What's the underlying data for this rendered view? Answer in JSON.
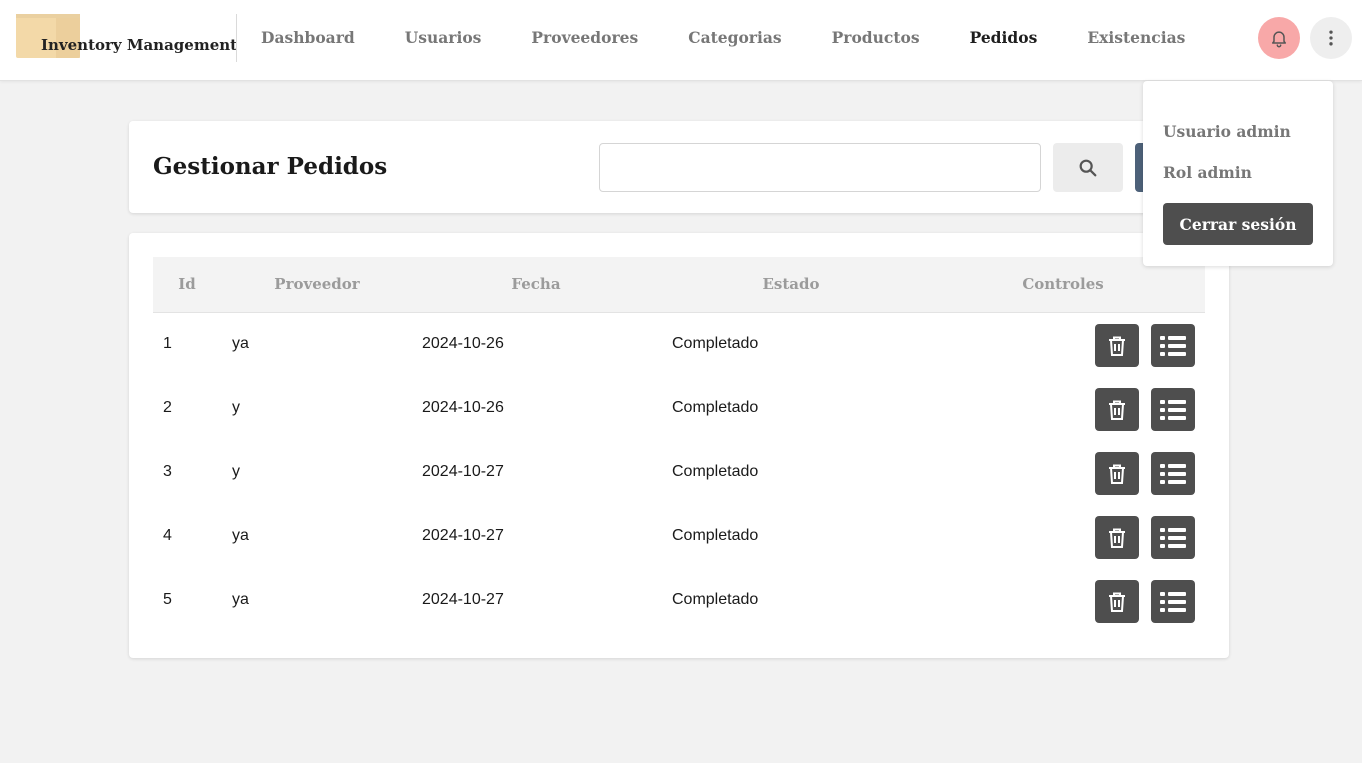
{
  "app": {
    "title": "Inventory Management"
  },
  "nav": {
    "items": [
      {
        "label": "Dashboard",
        "active": false
      },
      {
        "label": "Usuarios",
        "active": false
      },
      {
        "label": "Proveedores",
        "active": false
      },
      {
        "label": "Categorias",
        "active": false
      },
      {
        "label": "Productos",
        "active": false
      },
      {
        "label": "Pedidos",
        "active": true
      },
      {
        "label": "Existencias",
        "active": false
      }
    ]
  },
  "header_actions": {
    "notification_icon": "bell-icon",
    "menu_icon": "more-vertical-icon",
    "notification_color": "#f8a8a8"
  },
  "page": {
    "title": "Gestionar Pedidos"
  },
  "search": {
    "value": "",
    "placeholder": "",
    "icon": "search-icon",
    "add_button_color": "#4d6179"
  },
  "table": {
    "columns": [
      "Id",
      "Proveedor",
      "Fecha",
      "Estado",
      "Controles"
    ],
    "rows": [
      {
        "id": "1",
        "proveedor": "ya",
        "fecha": "2024-10-26",
        "estado": "Completado"
      },
      {
        "id": "2",
        "proveedor": "y",
        "fecha": "2024-10-26",
        "estado": "Completado"
      },
      {
        "id": "3",
        "proveedor": "y",
        "fecha": "2024-10-27",
        "estado": "Completado"
      },
      {
        "id": "4",
        "proveedor": "ya",
        "fecha": "2024-10-27",
        "estado": "Completado"
      },
      {
        "id": "5",
        "proveedor": "ya",
        "fecha": "2024-10-27",
        "estado": "Completado"
      }
    ],
    "control_icons": [
      "trash-icon",
      "list-icon"
    ]
  },
  "user_menu": {
    "user_label": "Usuario admin",
    "role_label": "Rol admin",
    "logout_label": "Cerrar sesión"
  },
  "colors": {
    "background": "#f2f2f2",
    "control_button": "#4e4e4e",
    "active_nav": "#1e1e1e",
    "inactive_nav": "#777777"
  }
}
